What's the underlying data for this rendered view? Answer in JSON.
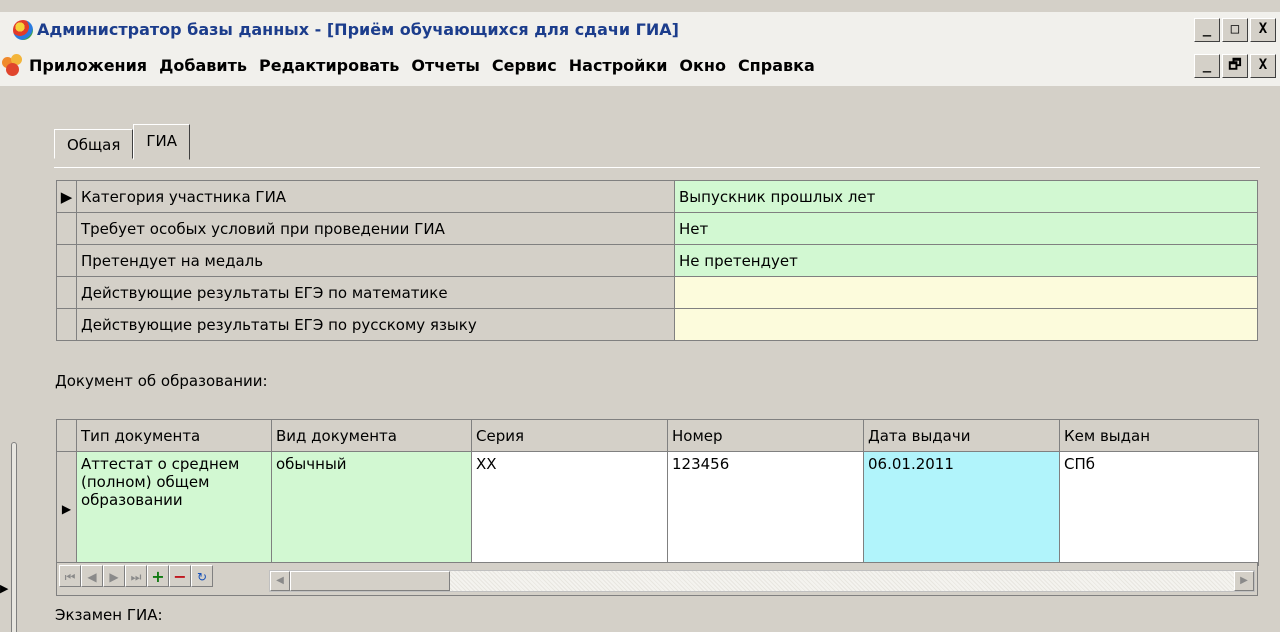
{
  "window": {
    "title": "Администратор базы данных - [Приём обучающихся для сдачи ГИА]",
    "minimize": "_",
    "maximize": "□",
    "close": "X"
  },
  "menu": {
    "items": [
      "Приложения",
      "Добавить",
      "Редактировать",
      "Отчеты",
      "Сервис",
      "Настройки",
      "Окно",
      "Справка"
    ],
    "mdi_minimize": "_",
    "mdi_restore": "🗗",
    "mdi_close": "X"
  },
  "tabs": [
    {
      "label": "Общая",
      "active": false
    },
    {
      "label": "ГИА",
      "active": true
    }
  ],
  "props": [
    {
      "label": "Категория участника ГИА",
      "value": "Выпускник прошлых лет",
      "current": true
    },
    {
      "label": "Требует особых условий при проведении ГИА",
      "value": "Нет",
      "current": false
    },
    {
      "label": "Претендует на медаль",
      "value": "Не претендует",
      "current": false
    },
    {
      "label": "Действующие результаты ЕГЭ по математике",
      "value": "",
      "current": false
    },
    {
      "label": "Действующие результаты ЕГЭ по русскому языку",
      "value": "",
      "current": false
    }
  ],
  "doc_section_label": "Документ об образовании:",
  "docs": {
    "columns": [
      "Тип документа",
      "Вид документа",
      "Серия",
      "Номер",
      "Дата выдачи",
      "Кем выдан"
    ],
    "rows": [
      {
        "type": "Аттестат о среднем (полном) общем образовании",
        "kind": "обычный",
        "series": "XX",
        "number": "123456",
        "date": "06.01.2011",
        "issued_by": "СПб"
      }
    ]
  },
  "navigator": {
    "first": "⏮",
    "prev": "◀",
    "next": "▶",
    "last": "⏭",
    "add": "+",
    "delete": "−",
    "refresh": "↻"
  },
  "exam_section_label": "Экзамен ГИА:",
  "colors": {
    "filled_value": "#d2f8d2",
    "empty_value": "#fcfbdc",
    "date_cell": "#b1f4fb",
    "title_text": "#1c3d8c"
  }
}
